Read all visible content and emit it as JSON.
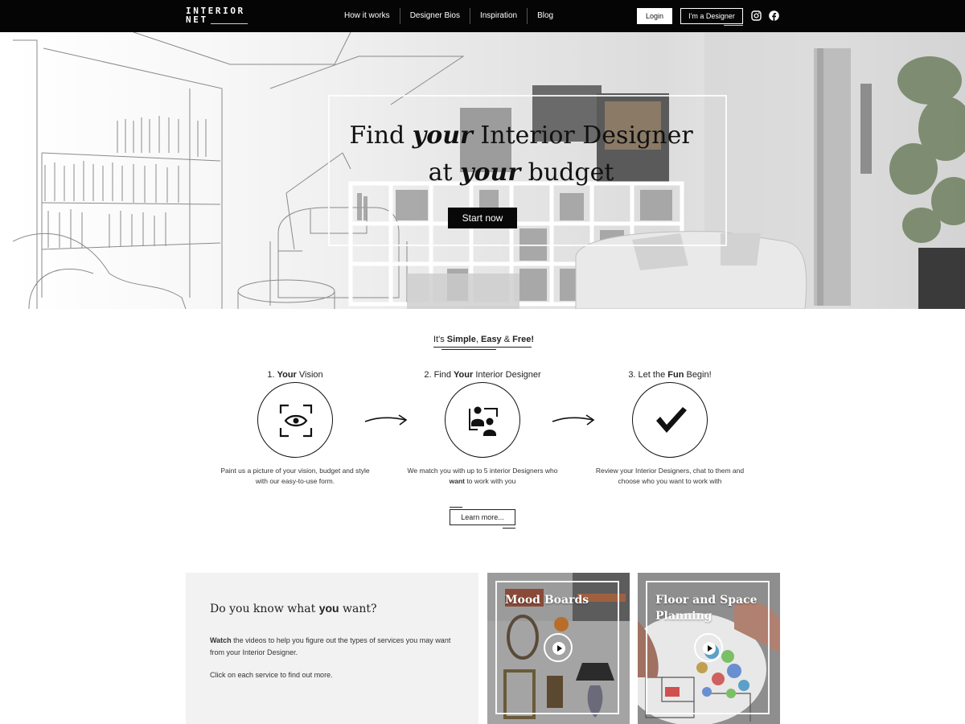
{
  "nav": {
    "logo_line1": "INTERIOR",
    "logo_line2": "NET",
    "links": [
      "How it works",
      "Designer Bios",
      "Inspiration",
      "Blog"
    ],
    "login": "Login",
    "designer": "I'm a Designer",
    "social": [
      "instagram-icon",
      "facebook-icon"
    ]
  },
  "hero": {
    "line1_a": "Find ",
    "line1_em": "your",
    "line1_b": " Interior Designer",
    "line2_a": "at ",
    "line2_em": "your",
    "line2_b": " budget",
    "cta": "Start now"
  },
  "steps": {
    "tagline_a": "It's ",
    "tagline_simple": "Simple",
    "tagline_sep": ", ",
    "tagline_easy": "Easy",
    "tagline_amp": " & ",
    "tagline_free": "Free!",
    "items": [
      {
        "num": "1. ",
        "bold": "Your",
        "rest": " Vision",
        "icon": "eye-focus-icon",
        "desc": "Paint us a picture of your vision, budget and style with our easy-to-use form."
      },
      {
        "num": "2. Find ",
        "bold": "Your",
        "rest": " Interior Designer",
        "icon": "designers-icon",
        "desc_a": "We match you with up to 5 interior Designers who ",
        "desc_bold": "want",
        "desc_b": " to work with you"
      },
      {
        "num": "3. Let the ",
        "bold": "Fun",
        "rest": " Begin!",
        "icon": "checkmark-icon",
        "desc": "Review your Interior Designers, chat to them and choose who you want to work with"
      }
    ],
    "learn_more": "Learn more..."
  },
  "info": {
    "heading_a": "Do you know what ",
    "heading_bold": "you",
    "heading_b": " want?",
    "para_bold": "Watch",
    "para_rest": " the videos to help you figure out the types of services you may want from your Interior Designer.",
    "para2": "Click on each service to find out more."
  },
  "cards": [
    {
      "title": "Mood Boards"
    },
    {
      "title": "Floor and Space Planning"
    }
  ]
}
